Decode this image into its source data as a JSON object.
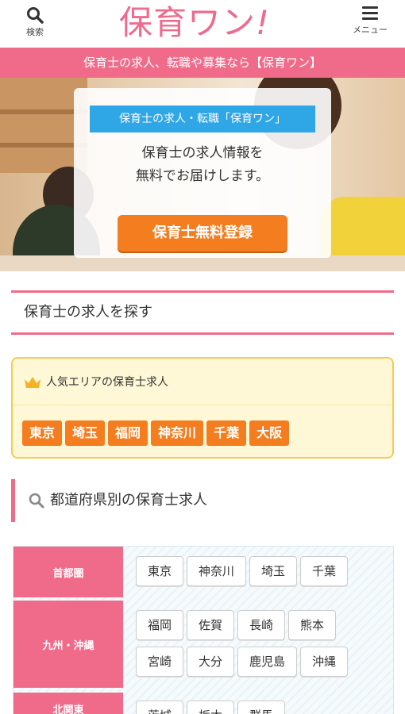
{
  "header": {
    "search_label": "検索",
    "logo": "保育ワン",
    "logo_bang": "!",
    "menu_label": "メニュー"
  },
  "banner": "保育士の求人、転職や募集なら【保育ワン】",
  "hero": {
    "tag": "保育士の求人・転職「保育ワン」",
    "message_line1": "保育士の求人情報を",
    "message_line2": "無料でお届けします。",
    "cta": "保育士無料登録"
  },
  "find": {
    "title": "保育士の求人を探す"
  },
  "popular": {
    "heading": "人気エリアの保育士求人",
    "areas": [
      "東京",
      "埼玉",
      "福岡",
      "神奈川",
      "千葉",
      "大阪"
    ]
  },
  "prefecture": {
    "title": "都道府県別の保育士求人",
    "regions": [
      {
        "name": "首都圏",
        "prefs": [
          "東京",
          "神奈川",
          "埼玉",
          "千葉"
        ]
      },
      {
        "name": "九州・沖縄",
        "prefs": [
          "福岡",
          "佐賀",
          "長崎",
          "熊本",
          "宮崎",
          "大分",
          "鹿児島",
          "沖縄"
        ]
      },
      {
        "name": "北関東",
        "prefs": [
          "茨城",
          "栃木",
          "群馬"
        ]
      }
    ]
  },
  "colors": {
    "brand_pink": "#f06b8a",
    "cta_orange": "#f47d1f",
    "tag_blue": "#2fa6e6",
    "popular_bg": "#fff8d6"
  }
}
